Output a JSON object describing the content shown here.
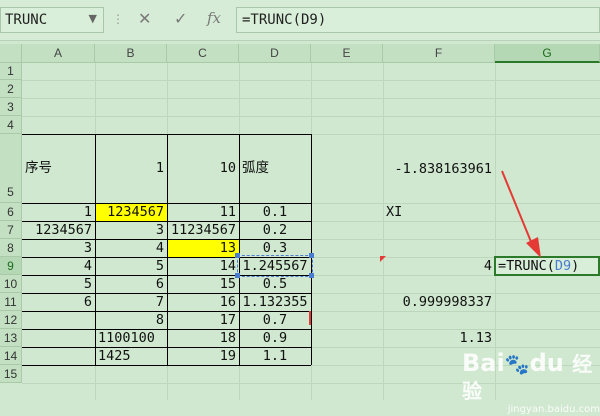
{
  "name_box": "TRUNC",
  "formula_bar": "=TRUNC(D9)",
  "toolbar": {
    "cancel": "✕",
    "enter": "✓",
    "fx": "fx"
  },
  "columns": [
    "A",
    "B",
    "C",
    "D",
    "E",
    "F",
    "G"
  ],
  "rows": [
    "1",
    "2",
    "3",
    "4",
    "5",
    "6",
    "7",
    "8",
    "9",
    "10",
    "11",
    "12",
    "13",
    "14",
    "15"
  ],
  "cells": {
    "A5": "序号",
    "C5": "10",
    "B5": "1",
    "D5": "弧度",
    "F5": "-1.838163961",
    "A6": "1",
    "B6": "1234567",
    "C6": "11",
    "D6": "0.1",
    "E6": "XI",
    "A7": "1234567",
    "B7": "3",
    "C7": "11234567",
    "D7": "0.2",
    "A8": "3",
    "B8": "4",
    "C8": "13",
    "D8": "0.3",
    "A9": "4",
    "B9": "5",
    "C9": "14",
    "D9": "1.245567",
    "F9": "4",
    "G9_prefix": "=TRUNC(",
    "G9_ref": "D9",
    "G9_suffix": ")",
    "A10": "5",
    "B10": "6",
    "C10": "15",
    "D10": "0.5",
    "A11": "6",
    "B11": "7",
    "C11": "16",
    "D11": "1.132355",
    "F11": "0.999998337",
    "B12": "8",
    "C12": "17",
    "D12": "0.7",
    "B13": "1100100",
    "C13": "18",
    "D13": "0.9",
    "F13": "1.13",
    "B14": "1425",
    "C14": "19",
    "D14": "1.1"
  },
  "colors": {
    "sheet_bg": "#cfe8cf",
    "highlight": "#ffff00",
    "arrow": "#e53935",
    "selection": "#2a7a2a",
    "reference": "#4a7cd1"
  },
  "watermark": {
    "brand": "Bai",
    "paw": "🐾",
    "brand2": "du",
    "product": "经验",
    "url": "jingyan.baidu.com"
  }
}
